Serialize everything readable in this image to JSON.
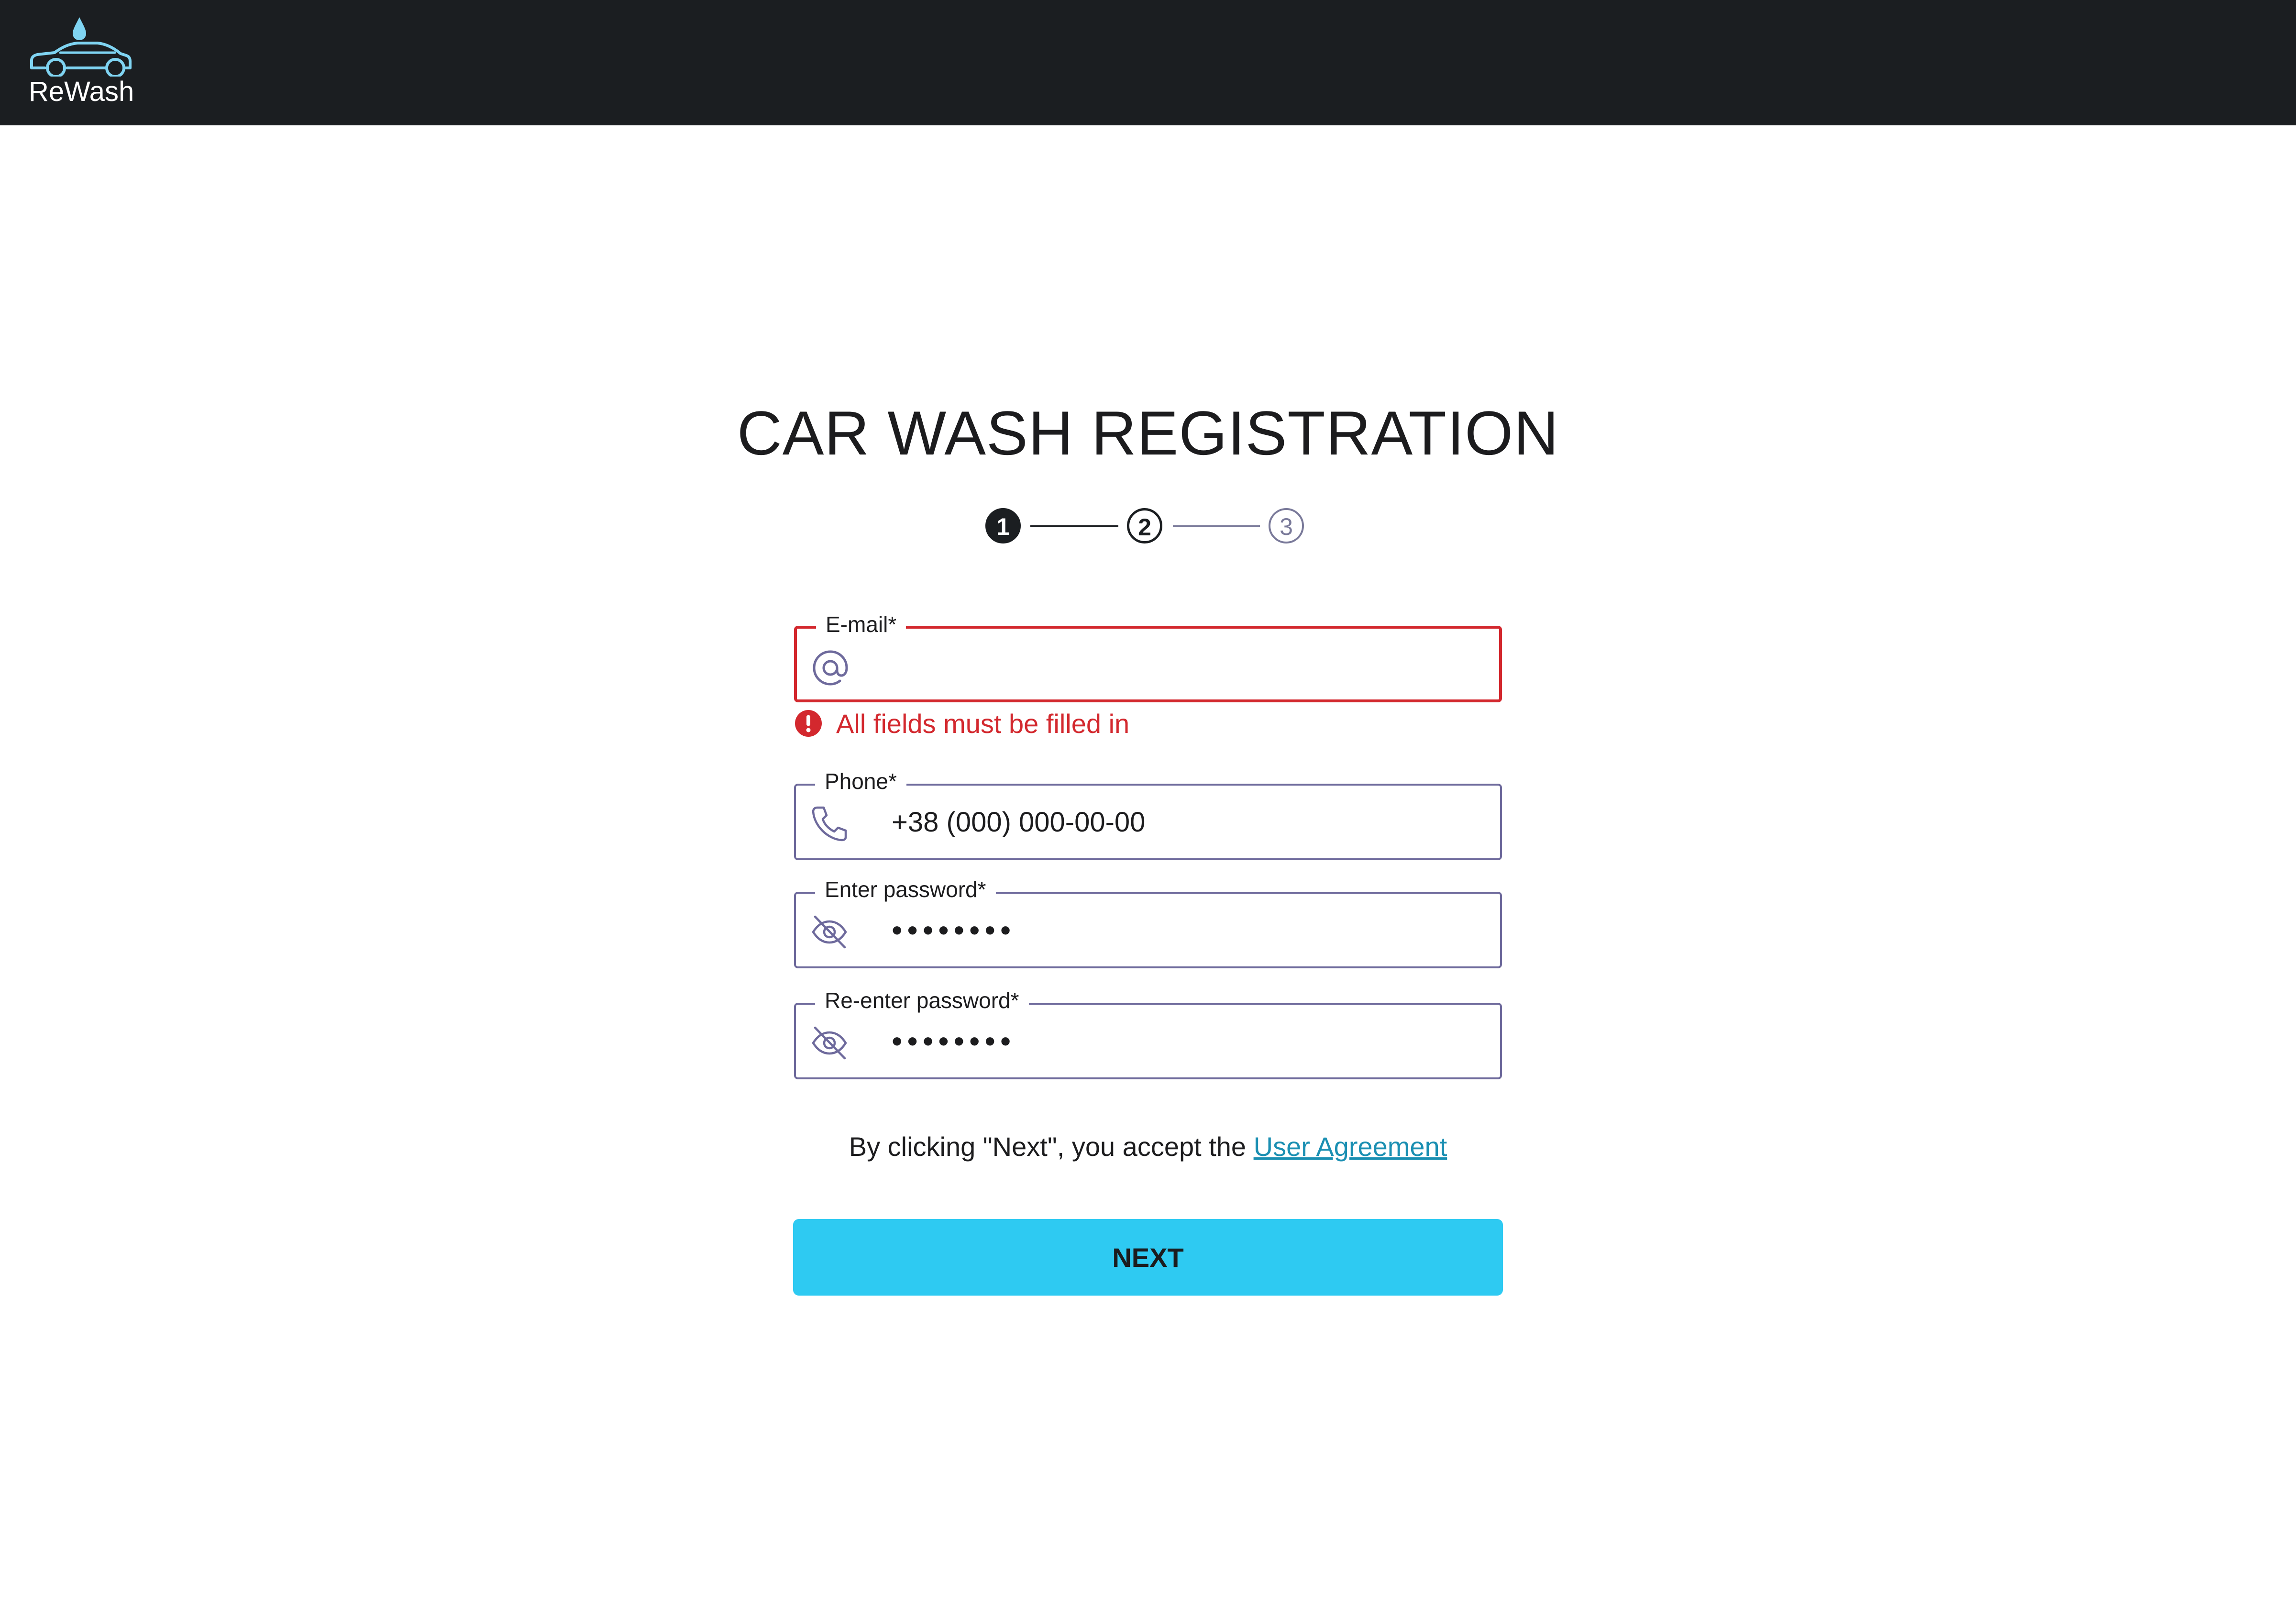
{
  "header": {
    "logo_text": "ReWash",
    "logo_icon": "car-wash-logo-icon"
  },
  "title": "CAR WASH REGISTRATION",
  "stepper": {
    "steps": [
      "1",
      "2",
      "3"
    ],
    "active_step": 1
  },
  "form": {
    "email": {
      "label": "E-mail*",
      "value": "",
      "icon": "at-sign-icon",
      "error": true
    },
    "error_message": "All fields must be filled in",
    "phone": {
      "label": "Phone*",
      "placeholder": "+38 (000) 000-00-00",
      "icon": "phone-icon"
    },
    "password": {
      "label": "Enter password*",
      "value": "••••••••",
      "icon": "eye-off-icon"
    },
    "password_confirm": {
      "label": "Re-enter password*",
      "value": "••••••••",
      "icon": "eye-off-icon"
    }
  },
  "agreement": {
    "text": "By clicking \"Next\", you accept the ",
    "link_text": "User Agreement"
  },
  "next_button": {
    "label": "NEXT"
  },
  "colors": {
    "header_bg": "#1b1e21",
    "accent": "#2ecaf2",
    "error": "#d3282e",
    "field_border": "#6e6a9c",
    "link": "#1a8fb2"
  }
}
